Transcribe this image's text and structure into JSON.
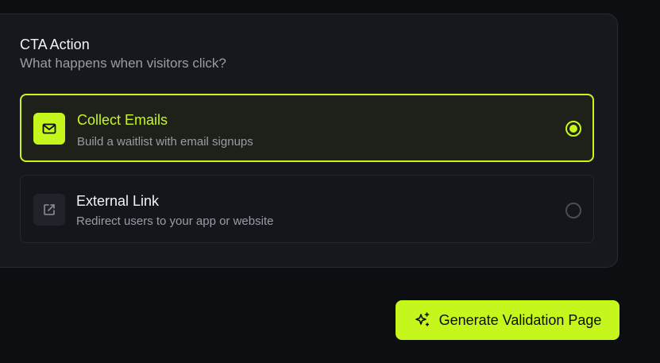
{
  "cta": {
    "title": "CTA Action",
    "subtitle": "What happens when visitors click?",
    "options": [
      {
        "title": "Collect Emails",
        "description": "Build a waitlist with email signups",
        "icon": "mail-icon",
        "selected": true
      },
      {
        "title": "External Link",
        "description": "Redirect users to your app or website",
        "icon": "external-link-icon",
        "selected": false
      }
    ]
  },
  "generate_button": {
    "label": "Generate Validation Page",
    "icon": "sparkles-icon"
  },
  "colors": {
    "accent": "#c6f71c",
    "background": "#0d0e12",
    "card": "#17181d"
  }
}
